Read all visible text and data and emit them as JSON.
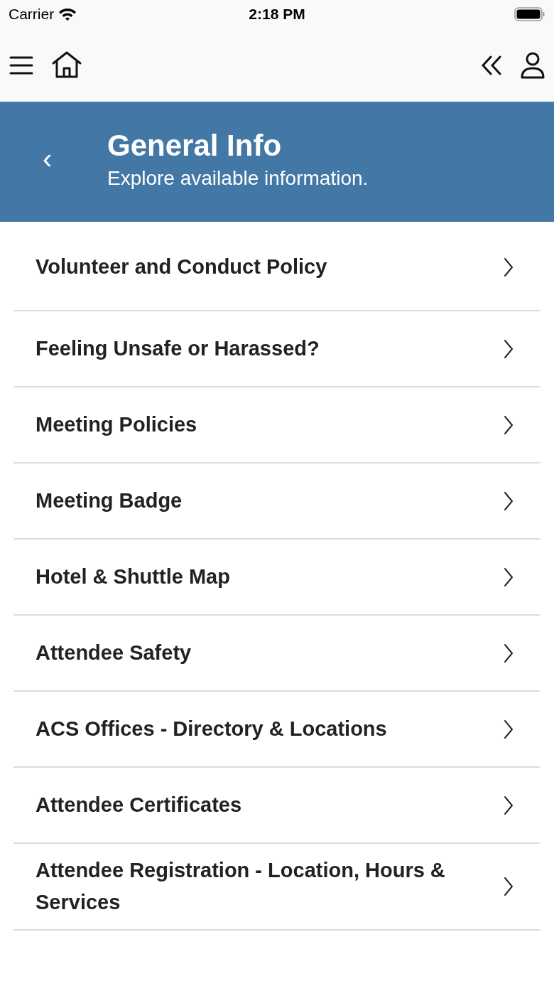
{
  "status_bar": {
    "carrier": "Carrier",
    "time": "2:18 PM"
  },
  "header": {
    "back": "‹",
    "title": "General Info",
    "subtitle": "Explore available information."
  },
  "items": [
    {
      "label": "Volunteer and Conduct Policy"
    },
    {
      "label": "Feeling Unsafe or Harassed?"
    },
    {
      "label": "Meeting Policies"
    },
    {
      "label": "Meeting Badge"
    },
    {
      "label": "Hotel & Shuttle Map"
    },
    {
      "label": "Attendee Safety"
    },
    {
      "label": "ACS Offices - Directory & Locations"
    },
    {
      "label": "Attendee Certificates"
    },
    {
      "label": "Attendee Registration - Location, Hours & Services"
    }
  ]
}
